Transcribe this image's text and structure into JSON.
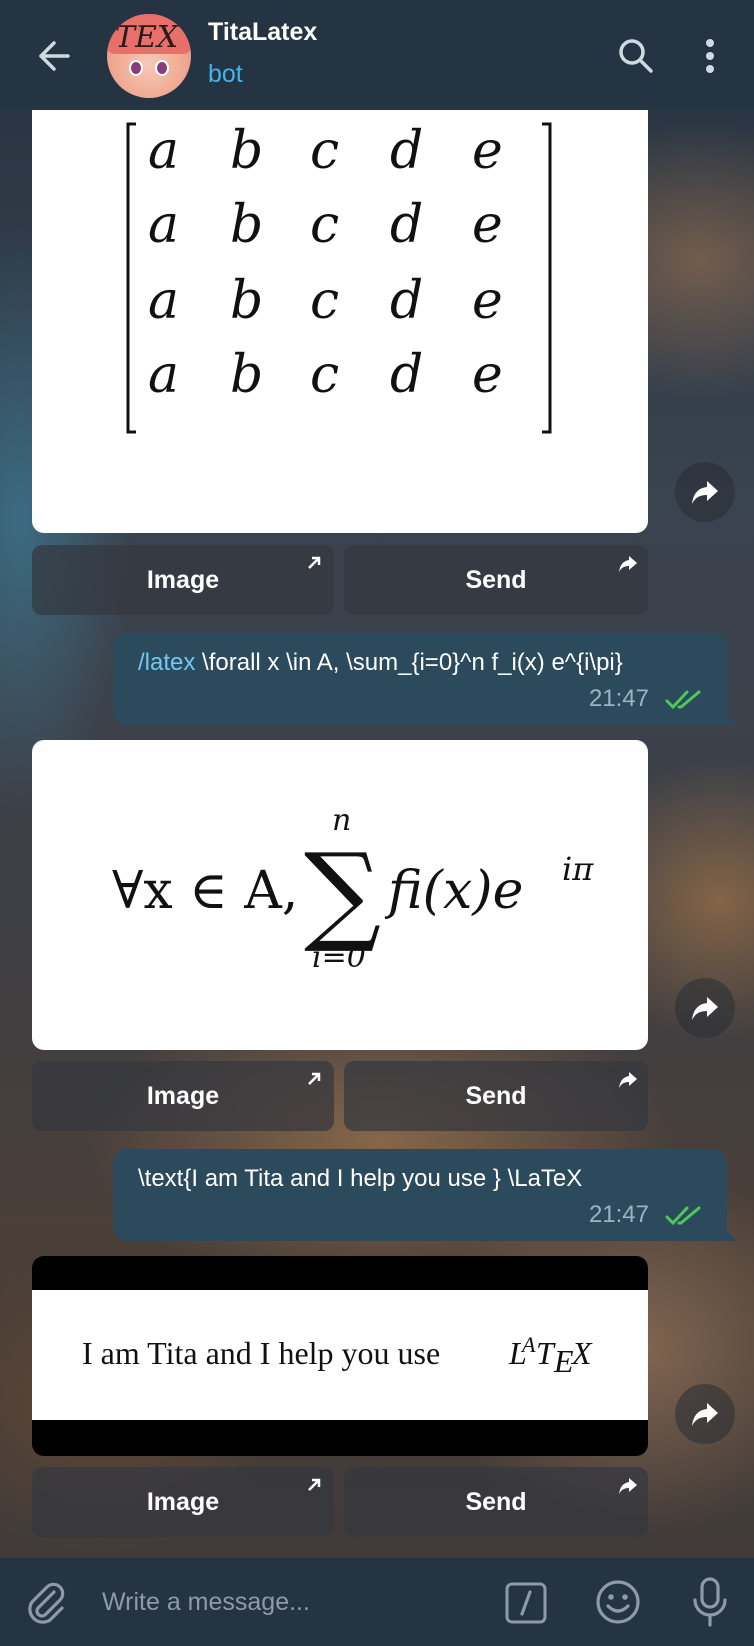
{
  "header": {
    "title": "TitaLatex",
    "subtitle": "bot"
  },
  "messages": [
    {
      "type": "image",
      "render": {
        "matrix_rows": [
          [
            "a",
            "b",
            "c",
            "d",
            "e"
          ],
          [
            "a",
            "b",
            "c",
            "d",
            "e"
          ],
          [
            "a",
            "b",
            "c",
            "d",
            "e"
          ],
          [
            "a",
            "b",
            "c",
            "d",
            "e"
          ]
        ]
      },
      "buttons": [
        {
          "label": "Image"
        },
        {
          "label": "Send"
        }
      ]
    },
    {
      "type": "outgoing",
      "command": "/latex",
      "text": " \\forall x \\in A, \\sum_{i=0}^n f_i(x) e^{i\\pi}",
      "time": "21:47"
    },
    {
      "type": "image",
      "render": {
        "forall": "∀x ∈ A,",
        "sum_upper": "n",
        "sum_lower": "i=0",
        "sum_body": "fi(x)e",
        "exponent": "iπ"
      },
      "buttons": [
        {
          "label": "Image"
        },
        {
          "label": "Send"
        }
      ]
    },
    {
      "type": "outgoing",
      "command": "",
      "text": "\\text{I am Tita and I help you use } \\LaTeX",
      "time": "21:47"
    },
    {
      "type": "image",
      "render": {
        "sentence": "I am Tita and I help you use"
      },
      "buttons": [
        {
          "label": "Image"
        },
        {
          "label": "Send"
        }
      ]
    }
  ],
  "input": {
    "placeholder": "Write a message..."
  },
  "colors": {
    "header_bg": "#253442",
    "accent": "#44b3e9",
    "bubble_out": "#2b4a5c",
    "read_tick": "#4fc759"
  },
  "icons": [
    "back-arrow-icon",
    "search-icon",
    "more-vertical-icon",
    "forward-icon",
    "external-link-icon",
    "share-icon",
    "double-check-icon",
    "attach-icon",
    "command-icon",
    "emoji-icon",
    "microphone-icon"
  ]
}
